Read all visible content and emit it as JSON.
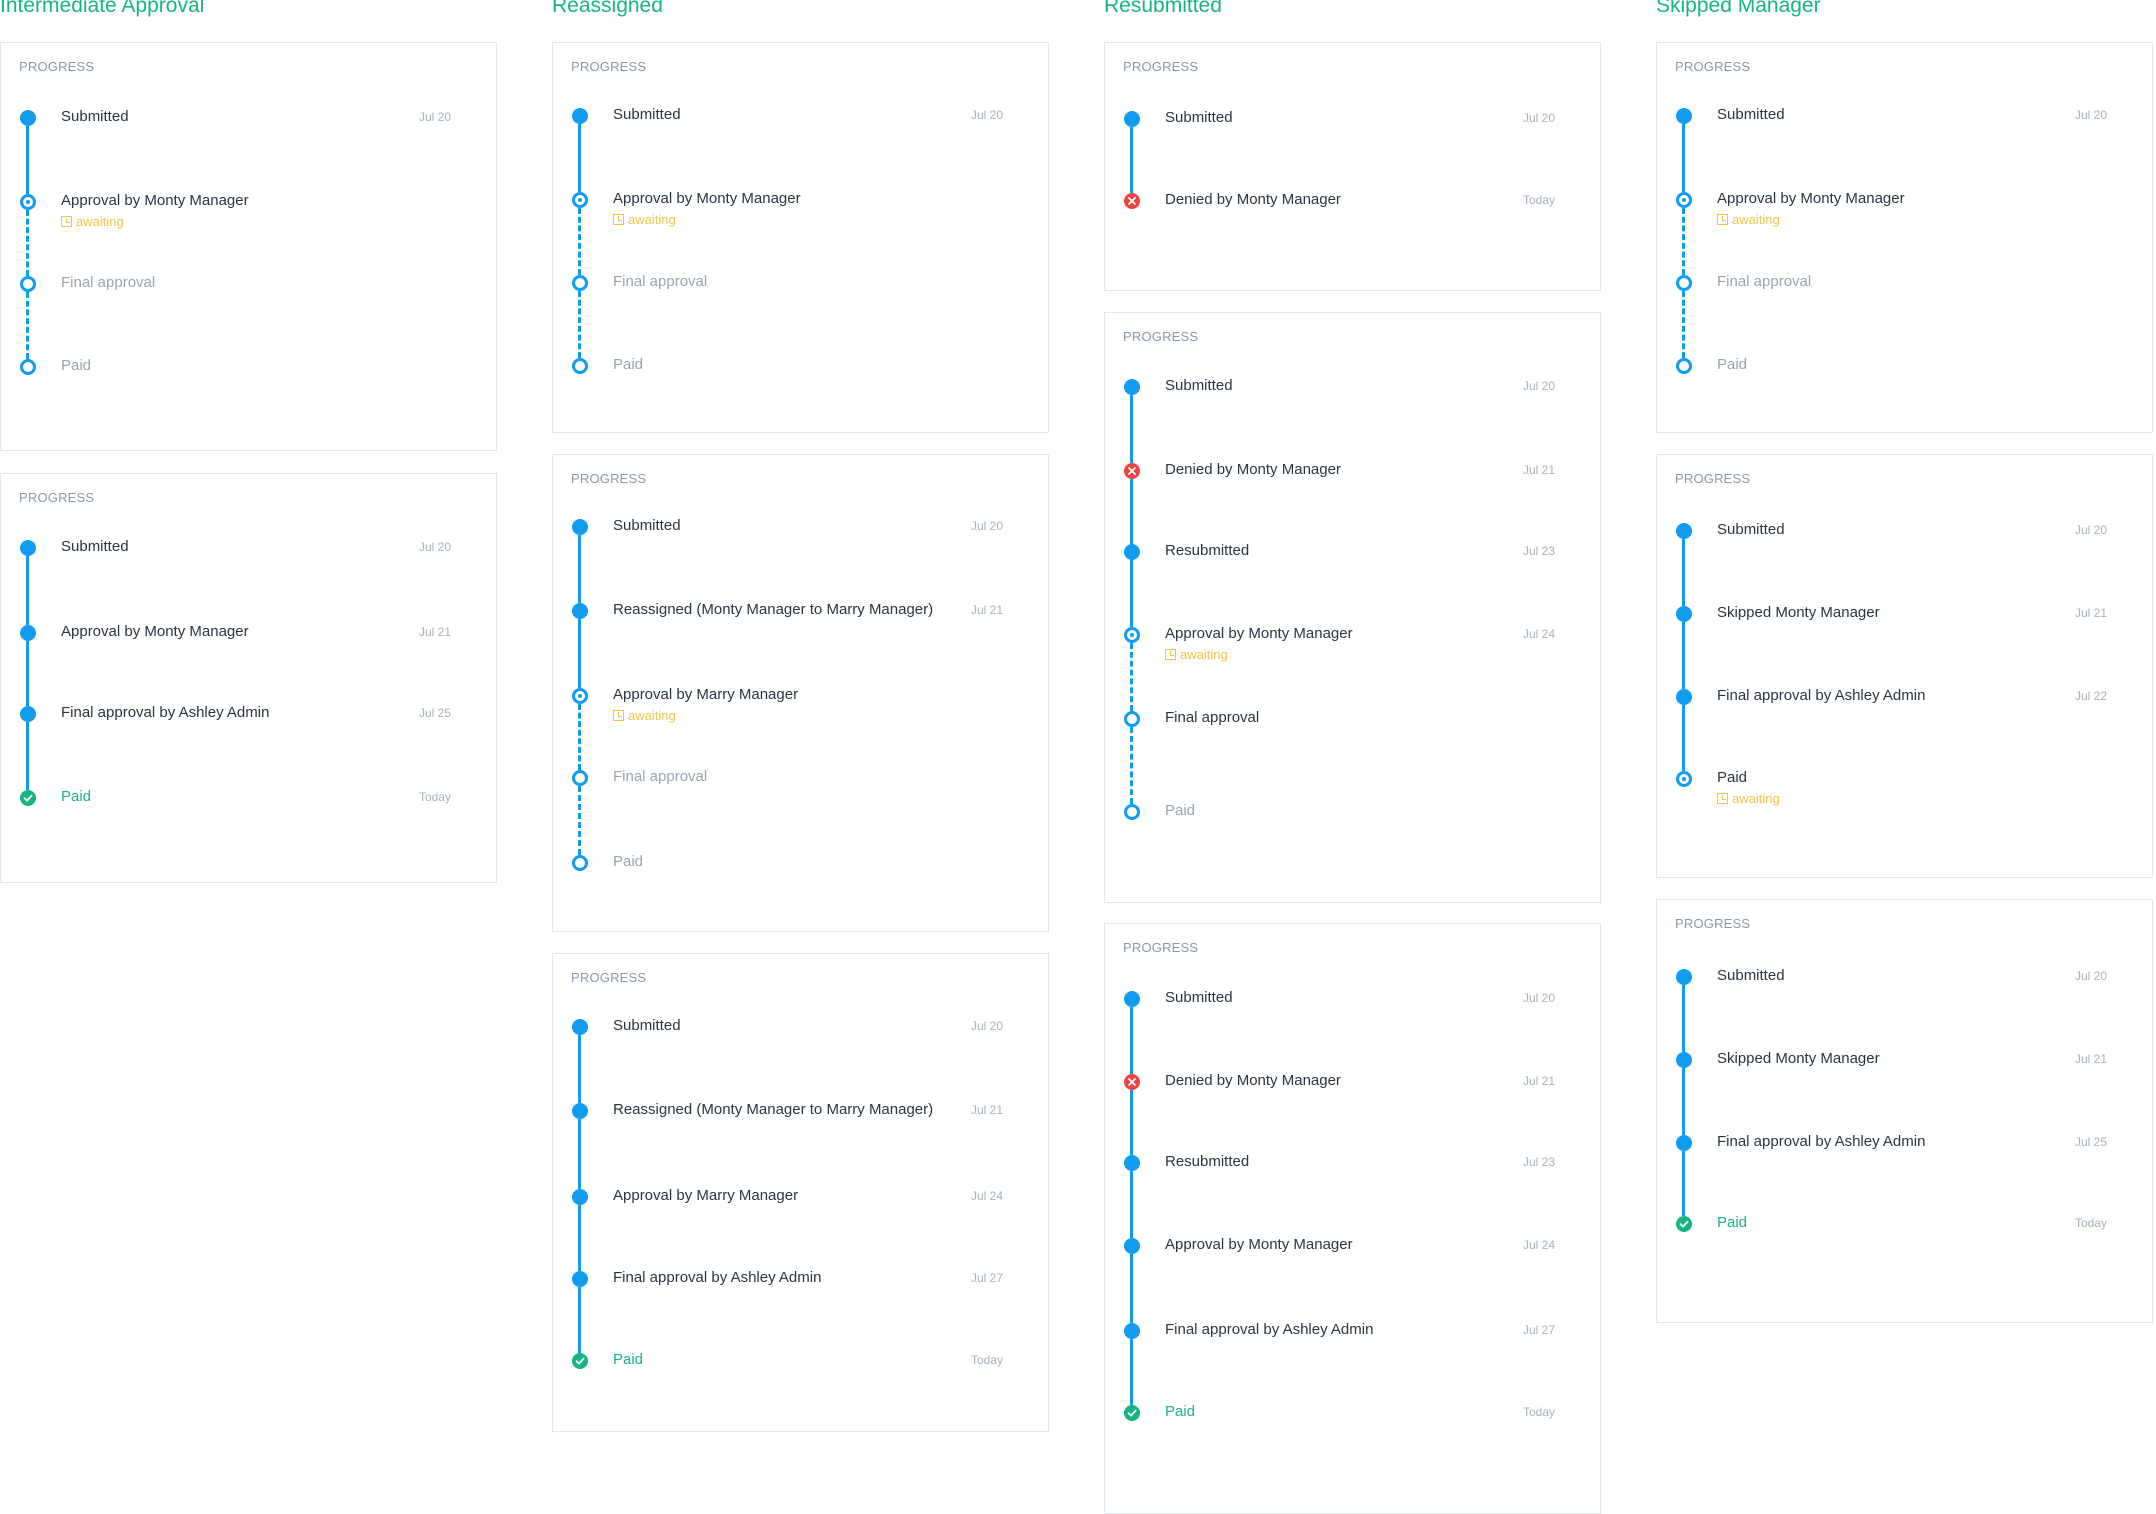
{
  "columns": [
    {
      "title": "Intermediate Approval",
      "cards": [
        {
          "label": "PROGRESS",
          "steps": [
            {
              "label": "Submitted",
              "date": "Jul 20",
              "state": "done"
            },
            {
              "label": "Approval by Monty Manager",
              "date": "",
              "state": "current",
              "status": "awaiting"
            },
            {
              "label": "Final approval",
              "date": "",
              "state": "todo"
            },
            {
              "label": "Paid",
              "date": "",
              "state": "todo"
            }
          ]
        },
        {
          "label": "PROGRESS",
          "steps": [
            {
              "label": "Submitted",
              "date": "Jul 20",
              "state": "done"
            },
            {
              "label": "Approval by Monty Manager",
              "date": "Jul 21",
              "state": "done"
            },
            {
              "label": "Final approval by Ashley Admin",
              "date": "Jul 25",
              "state": "done"
            },
            {
              "label": "Paid",
              "date": "Today",
              "state": "paid"
            }
          ]
        }
      ]
    },
    {
      "title": "Reassigned",
      "cards": [
        {
          "label": "PROGRESS",
          "steps": [
            {
              "label": "Submitted",
              "date": "Jul 20",
              "state": "done"
            },
            {
              "label": "Approval by Monty Manager",
              "date": "",
              "state": "current",
              "status": "awaiting"
            },
            {
              "label": "Final approval",
              "date": "",
              "state": "todo"
            },
            {
              "label": "Paid",
              "date": "",
              "state": "todo"
            }
          ]
        },
        {
          "label": "PROGRESS",
          "steps": [
            {
              "label": "Submitted",
              "date": "Jul 20",
              "state": "done"
            },
            {
              "label": "Reassigned (Monty Manager to Marry Manager)",
              "date": "Jul 21",
              "state": "done"
            },
            {
              "label": "Approval by Marry Manager",
              "date": "",
              "state": "current",
              "status": "awaiting"
            },
            {
              "label": "Final approval",
              "date": "",
              "state": "todo"
            },
            {
              "label": "Paid",
              "date": "",
              "state": "todo"
            }
          ]
        },
        {
          "label": "PROGRESS",
          "steps": [
            {
              "label": "Submitted",
              "date": "Jul 20",
              "state": "done"
            },
            {
              "label": "Reassigned (Monty Manager to Marry Manager)",
              "date": "Jul 21",
              "state": "done"
            },
            {
              "label": "Approval by Marry Manager",
              "date": "Jul 24",
              "state": "done"
            },
            {
              "label": "Final approval by Ashley Admin",
              "date": "Jul 27",
              "state": "done"
            },
            {
              "label": "Paid",
              "date": "Today",
              "state": "paid"
            }
          ]
        }
      ]
    },
    {
      "title": "Resubmitted",
      "cards": [
        {
          "label": "PROGRESS",
          "steps": [
            {
              "label": "Submitted",
              "date": "Jul 20",
              "state": "done"
            },
            {
              "label": "Denied by Monty Manager",
              "date": "Today",
              "state": "denied"
            }
          ]
        },
        {
          "label": "PROGRESS",
          "steps": [
            {
              "label": "Submitted",
              "date": "Jul 20",
              "state": "done"
            },
            {
              "label": "Denied by Monty Manager",
              "date": "Jul 21",
              "state": "denied"
            },
            {
              "label": "Resubmitted",
              "date": "Jul 23",
              "state": "done"
            },
            {
              "label": "Approval by Monty Manager",
              "date": "Jul 24",
              "state": "current",
              "status": "awaiting"
            },
            {
              "label": "Final approval",
              "date": "",
              "state": "todo",
              "emphasis": true
            },
            {
              "label": "Paid",
              "date": "",
              "state": "todo"
            }
          ]
        },
        {
          "label": "PROGRESS",
          "steps": [
            {
              "label": "Submitted",
              "date": "Jul 20",
              "state": "done"
            },
            {
              "label": "Denied by Monty Manager",
              "date": "Jul 21",
              "state": "denied"
            },
            {
              "label": "Resubmitted",
              "date": "Jul 23",
              "state": "done"
            },
            {
              "label": "Approval by Monty Manager",
              "date": "Jul 24",
              "state": "done"
            },
            {
              "label": "Final approval by Ashley Admin",
              "date": "Jul 27",
              "state": "done"
            },
            {
              "label": "Paid",
              "date": "Today",
              "state": "paid"
            }
          ]
        }
      ]
    },
    {
      "title": "Skipped Manager",
      "cards": [
        {
          "label": "PROGRESS",
          "steps": [
            {
              "label": "Submitted",
              "date": "Jul 20",
              "state": "done"
            },
            {
              "label": "Approval by Monty Manager",
              "date": "",
              "state": "current",
              "status": "awaiting"
            },
            {
              "label": "Final approval",
              "date": "",
              "state": "todo"
            },
            {
              "label": "Paid",
              "date": "",
              "state": "todo"
            }
          ]
        },
        {
          "label": "PROGRESS",
          "steps": [
            {
              "label": "Submitted",
              "date": "Jul 20",
              "state": "done"
            },
            {
              "label": "Skipped Monty Manager",
              "date": "Jul 21",
              "state": "done"
            },
            {
              "label": "Final approval by Ashley Admin",
              "date": "Jul 22",
              "state": "done"
            },
            {
              "label": "Paid",
              "date": "",
              "state": "current",
              "status": "awaiting",
              "emphasis": true
            }
          ]
        },
        {
          "label": "PROGRESS",
          "steps": [
            {
              "label": "Submitted",
              "date": "Jul 20",
              "state": "done"
            },
            {
              "label": "Skipped Monty Manager",
              "date": "Jul 21",
              "state": "done"
            },
            {
              "label": "Final approval by Ashley Admin",
              "date": "Jul 25",
              "state": "done"
            },
            {
              "label": "Paid",
              "date": "Today",
              "state": "paid"
            }
          ]
        }
      ]
    }
  ],
  "colors": {
    "accent": "#129cf0",
    "success": "#15b57f",
    "danger": "#ee4343",
    "awaiting": "#f5c242",
    "text": "#2a3541",
    "muted": "#9aa4b0"
  },
  "icons": {
    "done": "filled-circle-icon",
    "current": "target-circle-icon",
    "todo": "hollow-circle-icon",
    "denied": "x-circle-icon",
    "paid": "check-circle-icon",
    "status": "hourglass-icon"
  }
}
